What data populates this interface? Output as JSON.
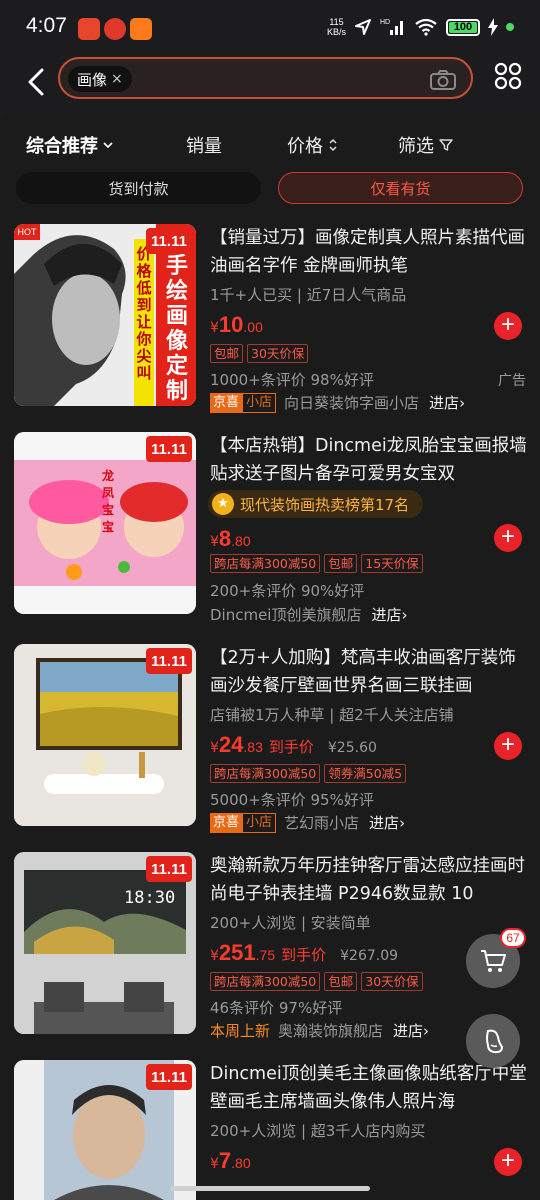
{
  "status_bar": {
    "time": "4:07",
    "speed_value": "115",
    "speed_unit": "KB/s",
    "battery": "100",
    "network": "HD"
  },
  "search": {
    "chip_label": "画像",
    "chip_remove": "×"
  },
  "filters": {
    "comprehensive": "综合推荐",
    "sales": "销量",
    "price": "价格",
    "filter": "筛选"
  },
  "toggles": {
    "cod": "货到付款",
    "in_stock": "仅看有货"
  },
  "badge_1111": "11.11",
  "products": [
    {
      "title": "【销量过万】画像定制真人照片素描代画油画名字作 金牌画师执笔",
      "sub": "1千+人已买 | 近7日人气商品",
      "price_currency": "¥",
      "price_int": "10",
      "price_dec": ".00",
      "tags": [
        "包邮",
        "30天价保"
      ],
      "reviews": "1000+条评价  98%好评",
      "ad": "广告",
      "shop_badge_a": "京喜",
      "shop_badge_b": "小店",
      "shop_name": "向日葵装饰字画小店",
      "enter": "进店",
      "img_text_a": "手绘画像定制",
      "img_text_b": "价格低到让你尖叫",
      "hot": "HOT"
    },
    {
      "title": "【本店热销】Dincmei龙凤胎宝宝画报墙贴求送子图片备孕可爱男女宝双",
      "rank": "现代装饰画热卖榜第17名",
      "price_currency": "¥",
      "price_int": "8",
      "price_dec": ".80",
      "tags": [
        "跨店每满300减50",
        "包邮",
        "15天价保"
      ],
      "reviews": "200+条评价  90%好评",
      "shop_name": "Dincmei顶创美旗舰店",
      "enter": "进店",
      "img_text": "龙凤宝宝"
    },
    {
      "title": "【2万+人加购】梵高丰收油画客厅装饰画沙发餐厅壁画世界名画三联挂画",
      "sub": "店铺被1万人种草 | 超2千人关注店铺",
      "price_currency": "¥",
      "price_int": "24",
      "price_dec": ".83",
      "hand_label": "到手价",
      "orig": "¥25.60",
      "tags": [
        "跨店每满300减50",
        "领券满50减5"
      ],
      "reviews": "5000+条评价  95%好评",
      "shop_badge_a": "京喜",
      "shop_badge_b": "小店",
      "shop_name": "艺幻雨小店",
      "enter": "进店"
    },
    {
      "title": "奥瀚新款万年历挂钟客厅雷达感应挂画时尚电子钟表挂墙 P2946数显款 10",
      "sub": "200+人浏览 | 安装简单",
      "price_currency": "¥",
      "price_int": "251",
      "price_dec": ".75",
      "hand_label": "到手价",
      "orig": "¥267.09",
      "tags": [
        "跨店每满300减50",
        "包邮",
        "30天价保"
      ],
      "reviews": "46条评价  97%好评",
      "new_tag": "本周上新",
      "shop_name": "奥瀚装饰旗舰店",
      "enter": "进店",
      "clock": "18:30"
    },
    {
      "title": "Dincmei顶创美毛主像画像贴纸客厅中堂壁画毛主席墙画头像伟人照片海",
      "sub": "200+人浏览 | 超3千人店内购买",
      "price_currency": "¥",
      "price_int": "7",
      "price_dec": ".80"
    }
  ],
  "cart_count": "67",
  "colors": {
    "accent": "#e9232a",
    "price": "#ff3b2f",
    "background": "#1b1b1b"
  }
}
